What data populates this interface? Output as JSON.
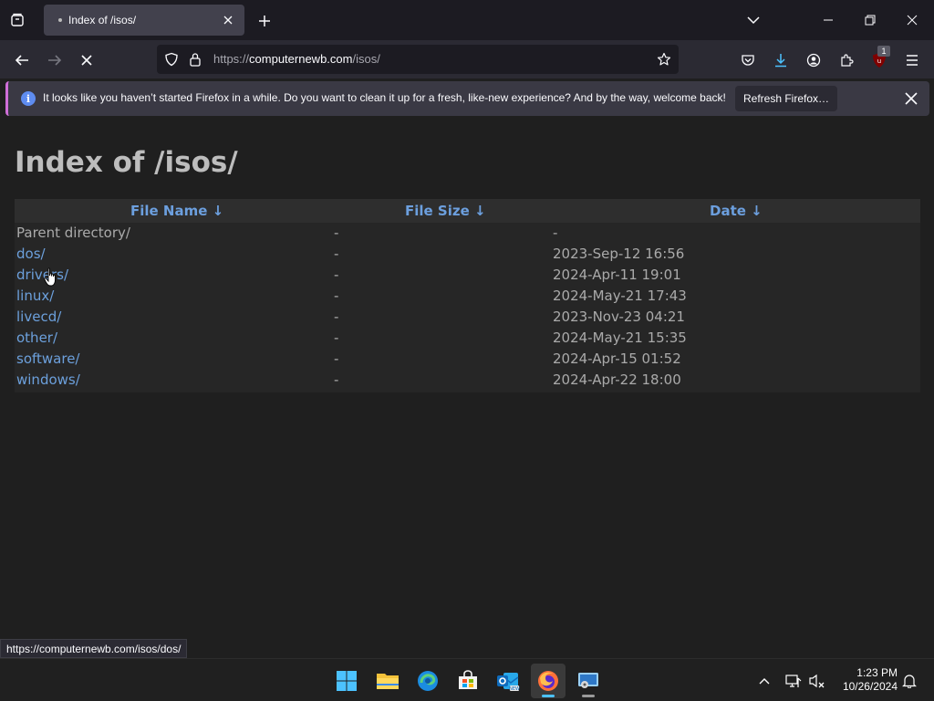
{
  "browser": {
    "tab": {
      "title": "Index of /isos/"
    },
    "url": {
      "prefix": "https://",
      "host": "computernewb.com",
      "path": "/isos/"
    },
    "extension_badge": "1"
  },
  "notification": {
    "message": "It looks like you haven’t started Firefox in a while. Do you want to clean it up for a fresh, like-new experience? And by the way, welcome back!",
    "button": "Refresh Firefox…"
  },
  "page": {
    "heading": "Index of /isos/",
    "columns": {
      "name": "File Name  ↓",
      "size": "File Size  ↓",
      "date": "Date  ↓"
    },
    "rows": [
      {
        "name": "Parent directory/",
        "size": "-",
        "date": "-"
      },
      {
        "name": "dos/",
        "size": "-",
        "date": "2023-Sep-12 16:56"
      },
      {
        "name": "drivers/",
        "size": "-",
        "date": "2024-Apr-11 19:01"
      },
      {
        "name": "linux/",
        "size": "-",
        "date": "2024-May-21 17:43"
      },
      {
        "name": "livecd/",
        "size": "-",
        "date": "2023-Nov-23 04:21"
      },
      {
        "name": "other/",
        "size": "-",
        "date": "2024-May-21 15:35"
      },
      {
        "name": "software/",
        "size": "-",
        "date": "2024-Apr-15 01:52"
      },
      {
        "name": "windows/",
        "size": "-",
        "date": "2024-Apr-22 18:00"
      }
    ]
  },
  "status_url": "https://computernewb.com/isos/dos/",
  "taskbar": {
    "apps": [
      "start-icon",
      "file-explorer-icon",
      "edge-icon",
      "store-icon",
      "outlook-icon",
      "firefox-icon",
      "vm-viewer-icon"
    ],
    "time": "1:23 PM",
    "date": "10/26/2024"
  },
  "colors": {
    "link": "#6ca0dc",
    "accent": "#4cc2ff",
    "notif_border": "#d06fd8"
  }
}
